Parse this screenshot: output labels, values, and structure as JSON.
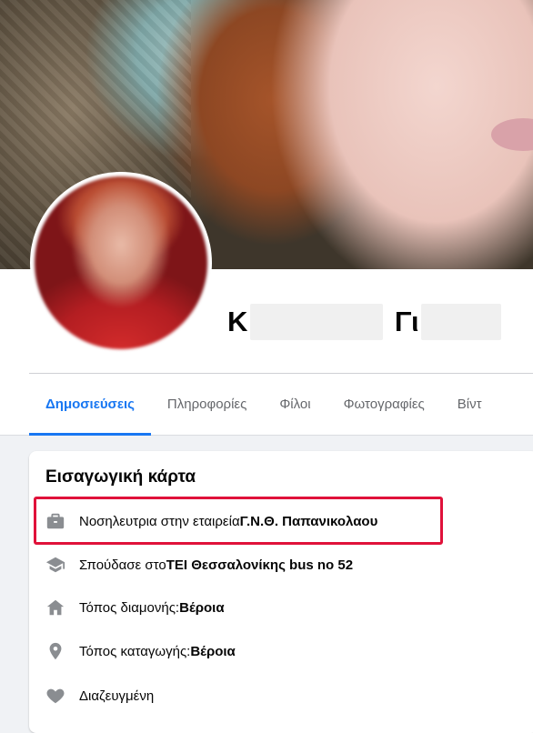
{
  "profile": {
    "name_first_initial": "K",
    "name_last_initial": "Γι"
  },
  "tabs": [
    {
      "label": "Δημοσιεύσεις"
    },
    {
      "label": "Πληροφορίες"
    },
    {
      "label": "Φίλοι"
    },
    {
      "label": "Φωτογραφίες"
    },
    {
      "label": "Βίντ"
    }
  ],
  "intro": {
    "title": "Εισαγωγική κάρτα",
    "items": [
      {
        "icon": "briefcase-icon",
        "prefix": "Νοσηλευτρια στην εταιρεία ",
        "bold": "Γ.Ν.Θ. Παπανικολαου"
      },
      {
        "icon": "graduation-cap-icon",
        "prefix": "Σπούδασε στο ",
        "bold": "ΤΕΙ Θεσσαλονίκης bus no 52"
      },
      {
        "icon": "home-icon",
        "prefix": "Τόπος διαμονής: ",
        "bold": "Βέροια"
      },
      {
        "icon": "location-pin-icon",
        "prefix": "Τόπος καταγωγής: ",
        "bold": "Βέροια"
      },
      {
        "icon": "heart-icon",
        "prefix": "Διαζευγμένη",
        "bold": ""
      }
    ]
  },
  "colors": {
    "accent": "#1877f2",
    "highlight_box": "#e0123a"
  }
}
